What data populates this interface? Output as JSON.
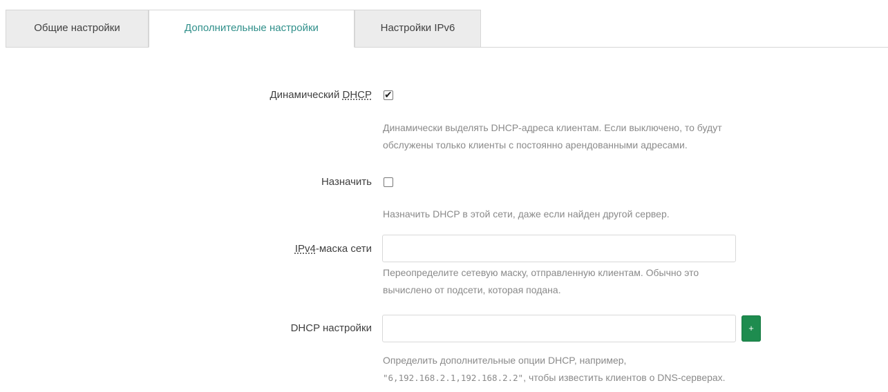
{
  "tabs": [
    {
      "label": "Общие настройки",
      "active": false
    },
    {
      "label": "Дополнительные настройки",
      "active": true
    },
    {
      "label": "Настройки IPv6",
      "active": false
    }
  ],
  "fields": {
    "dynamic_dhcp": {
      "label_prefix": "Динамический ",
      "label_abbr": "DHCP",
      "checked": true,
      "help_line1": "Динамически выделять DHCP-адреса клиентам. Если выключено, то будут",
      "help_line2": "обслужены только клиенты с постоянно арендованными адресами."
    },
    "force": {
      "label": "Назначить",
      "checked": false,
      "help": "Назначить DHCP в этой сети, даже если найден другой сервер."
    },
    "netmask": {
      "label_abbr": "IPv4",
      "label_suffix": "-маска сети",
      "value": "",
      "help_line1": "Переопределите сетевую маску, отправленную клиентам. Обычно это",
      "help_line2": "вычислено от подсети, которая подана."
    },
    "dhcp_options": {
      "label": "DHCP настройки",
      "value": "",
      "add_button": "+",
      "help_line1": "Определить дополнительные опции DHCP, например,",
      "help_code": "\"6,192.168.2.1,192.168.2.2\"",
      "help_line2_suffix": ", чтобы известить клиентов о DNS-серверах."
    }
  },
  "colors": {
    "active_tab_text": "#2f8f8a",
    "add_button": "#1e8c4f",
    "help_text": "#8a8a8a"
  }
}
